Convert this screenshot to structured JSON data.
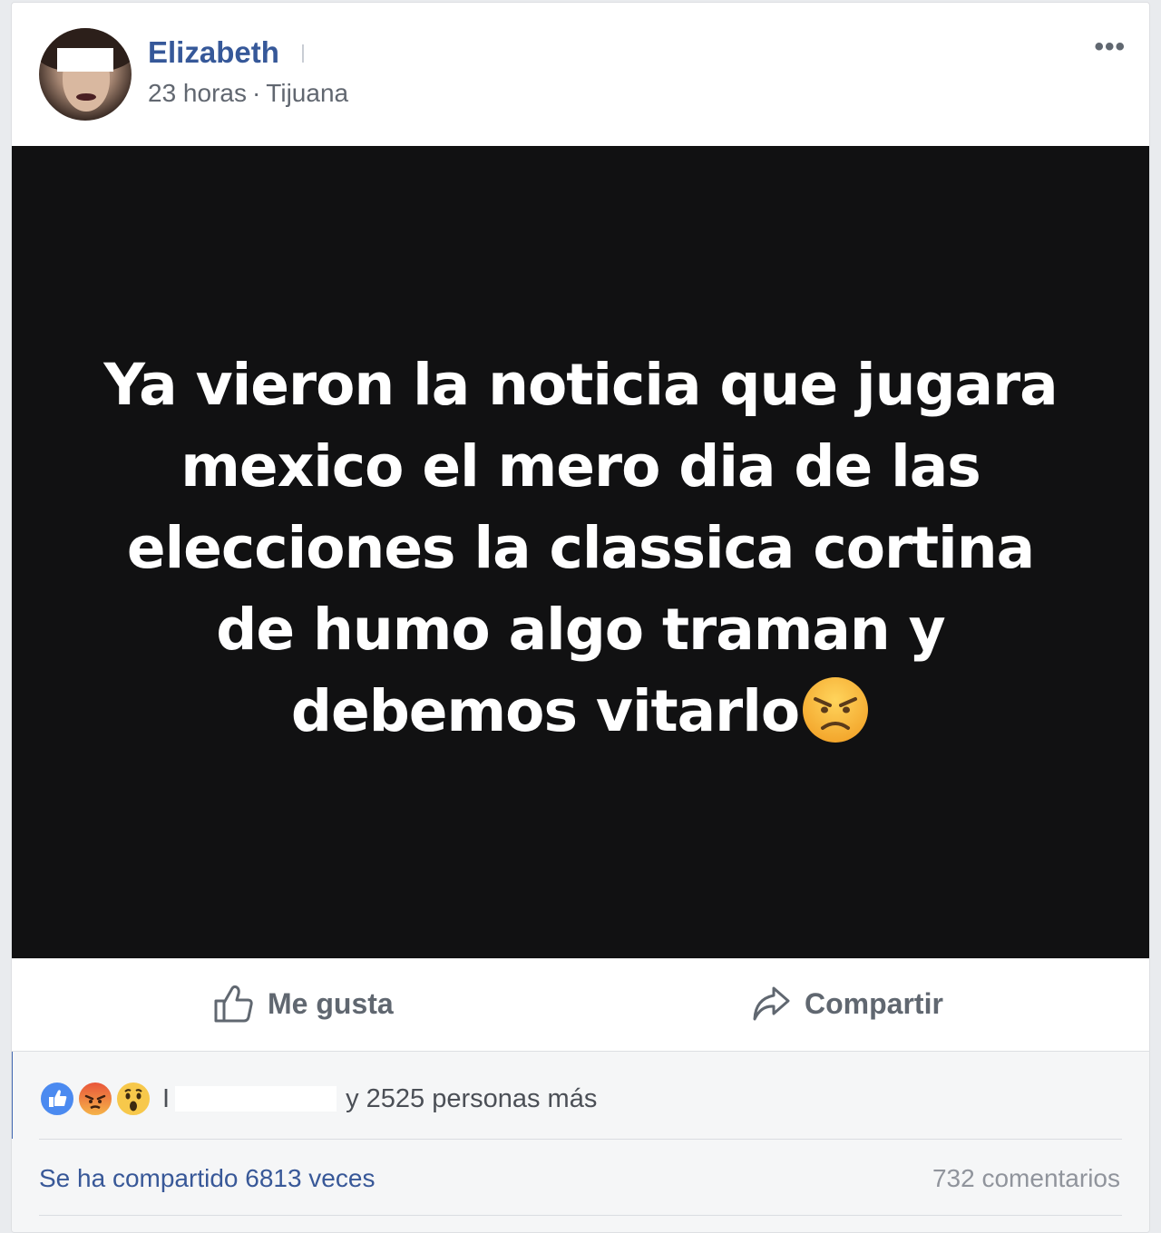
{
  "post": {
    "author": "Elizabeth",
    "time": "23 horas",
    "separator": "·",
    "location": "Tijuana",
    "more_icon": "ellipsis-icon",
    "image_text": "Ya vieron la noticia que jugara mexico el mero dia de las elecciones la classica cortina de humo algo traman y debemos vitarlo"
  },
  "actions": {
    "like_label": "Me gusta",
    "share_label": "Compartir"
  },
  "stats": {
    "reactions": [
      "like",
      "angry",
      "wow"
    ],
    "reactions_leading": "I",
    "reactions_text": "y 2525 personas más",
    "shares_text": "Se ha compartido 6813 veces",
    "comments_text": "732 comentarios"
  },
  "colors": {
    "link_blue": "#365899",
    "image_background": "#111112",
    "muted_text": "#616770"
  }
}
